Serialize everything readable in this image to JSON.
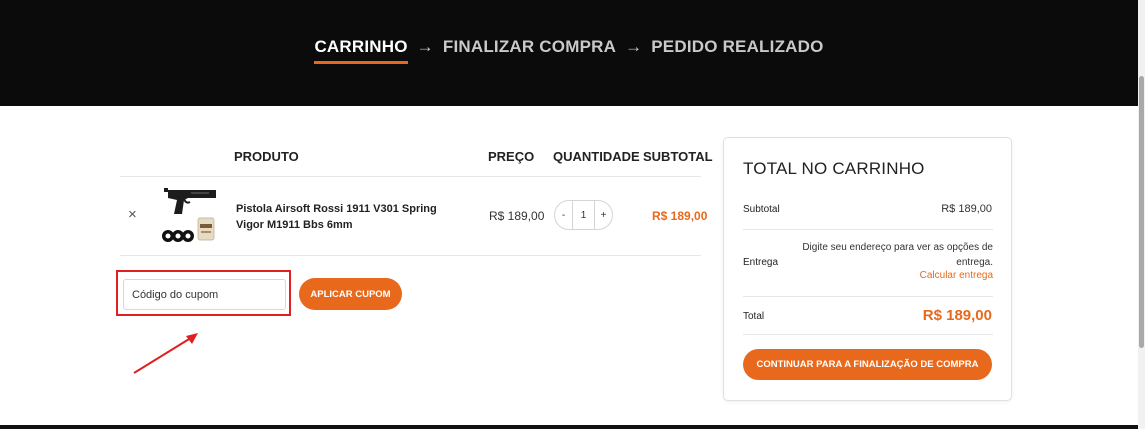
{
  "steps": {
    "cart": "CARRINHO",
    "checkout": "FINALIZAR COMPRA",
    "order": "PEDIDO REALIZADO",
    "arrow": "→"
  },
  "table": {
    "headers": {
      "product": "PRODUTO",
      "price": "PREÇO",
      "quantity": "QUANTIDADE",
      "subtotal": "SUBTOTAL"
    },
    "row": {
      "remove": "×",
      "name": "Pistola Airsoft Rossi 1911 V301 Spring Vigor M1911 Bbs 6mm",
      "price": "R$ 189,00",
      "qty_minus": "-",
      "qty_value": "1",
      "qty_plus": "+",
      "subtotal": "R$ 189,00"
    }
  },
  "coupon": {
    "placeholder": "Código do cupom",
    "apply_label": "APLICAR CUPOM"
  },
  "totals": {
    "title": "TOTAL NO CARRINHO",
    "subtotal_label": "Subtotal",
    "subtotal_value": "R$ 189,00",
    "shipping_label": "Entrega",
    "shipping_text": "Digite seu endereço para ver as opções de entrega.",
    "shipping_link": "Calcular entrega",
    "total_label": "Total",
    "total_value": "R$ 189,00",
    "checkout_label": "CONTINUAR PARA A FINALIZAÇÃO DE COMPRA"
  },
  "colors": {
    "accent": "#e8691c",
    "header_bg": "#0b0b0b",
    "highlight": "#e02020"
  }
}
